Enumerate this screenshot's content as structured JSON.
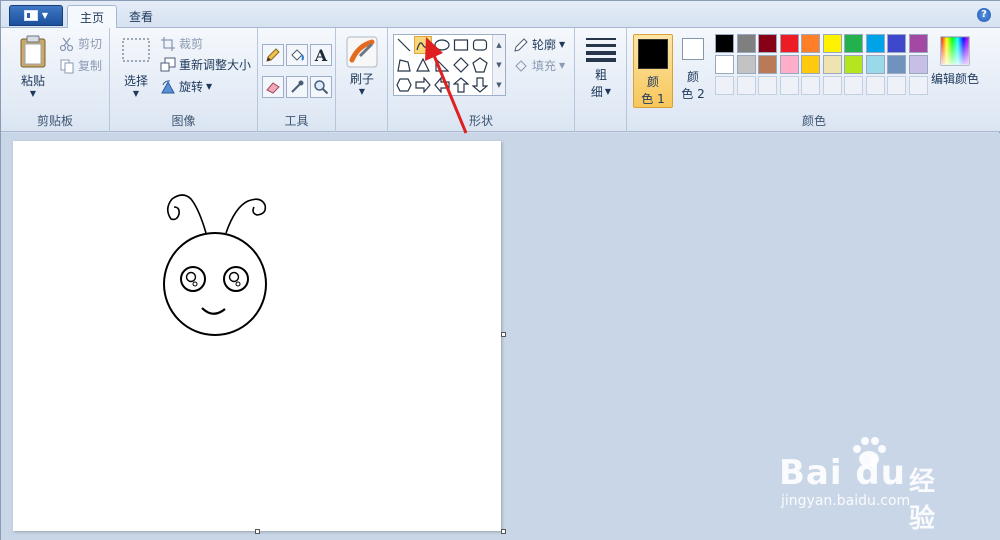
{
  "tabs": {
    "home": "主页",
    "view": "查看"
  },
  "help_glyph": "?",
  "clipboard": {
    "paste": "粘贴",
    "cut": "剪切",
    "copy": "复制",
    "label": "剪贴板"
  },
  "image": {
    "select": "选择",
    "crop": "裁剪",
    "resize": "重新调整大小",
    "rotate": "旋转",
    "label": "图像"
  },
  "tools": {
    "text_glyph": "A",
    "label": "工具"
  },
  "brushes": {
    "label": "刷子"
  },
  "shapes": {
    "outline": "轮廓",
    "fill": "填充",
    "label": "形状",
    "selected": "curve"
  },
  "size": {
    "line1": "粗",
    "line2": "细"
  },
  "colors": {
    "color1_line1": "颜",
    "color1_line2": "色 1",
    "color2_line1": "颜",
    "color2_line2": "色 2",
    "edit": "编辑颜色",
    "label": "颜色",
    "color1_value": "#000000",
    "color2_value": "#ffffff",
    "palette_row1": [
      "#000000",
      "#7f7f7f",
      "#880015",
      "#ed1c24",
      "#ff7f27",
      "#fff200",
      "#22b14c",
      "#00a2e8",
      "#3f48cc",
      "#a349a4"
    ],
    "palette_row2": [
      "#ffffff",
      "#c3c3c3",
      "#b97a57",
      "#ffaec9",
      "#ffc90e",
      "#efe4b0",
      "#b5e61d",
      "#99d9ea",
      "#7092be",
      "#c8bfe7"
    ]
  },
  "watermark": {
    "brand": "Bai du",
    "cn": "经验",
    "url": "jingyan.baidu.com"
  }
}
